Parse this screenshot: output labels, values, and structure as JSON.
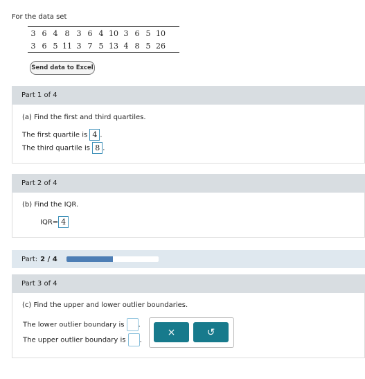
{
  "intro": "For the data set",
  "data_rows": [
    [
      "3",
      "6",
      "4",
      "8",
      "3",
      "6",
      "4",
      "10",
      "3",
      "6",
      "5",
      "10"
    ],
    [
      "3",
      "6",
      "5",
      "11",
      "3",
      "7",
      "5",
      "13",
      "4",
      "8",
      "5",
      "26"
    ]
  ],
  "excel_button": "Send data to Excel",
  "part1": {
    "header": "Part 1 of 4",
    "question": "(a) Find the first and third quartiles.",
    "q1_prefix": "The first quartile is",
    "q1_value": "4",
    "q3_prefix": "The third quartile is",
    "q3_value": "8",
    "period": "."
  },
  "part2": {
    "header": "Part 2 of 4",
    "question": "(b) Find the IQR.",
    "iqr_prefix": "IQR=",
    "iqr_value": "4"
  },
  "progress": {
    "label": "Part:",
    "value": "2 / 4",
    "fraction": 0.5
  },
  "part3": {
    "header": "Part 3 of 4",
    "question": "(c) Find the upper and lower outlier boundaries.",
    "lower_prefix": "The lower outlier boundary is",
    "upper_prefix": "The upper outlier boundary is",
    "period": "."
  },
  "tools": {
    "clear_glyph": "×",
    "undo_glyph": "↺"
  },
  "colors": {
    "accent": "#177a8c",
    "progress_fill": "#4d7eb5",
    "header_bg": "#d8dde1"
  }
}
